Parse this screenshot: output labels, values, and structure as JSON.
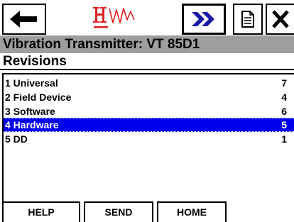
{
  "logo": {
    "text": "HW"
  },
  "toolbar": {
    "back_icon": "left-arrow-icon",
    "forward_icon": "double-chevron-right-icon",
    "doc_icon": "document-icon",
    "close_icon": "close-x-icon"
  },
  "header": {
    "title": "Vibration Transmitter: VT 85D1",
    "subtitle": "Revisions"
  },
  "revisions": [
    {
      "label": "1 Universal",
      "value": "7",
      "selected": false
    },
    {
      "label": "2 Field Device",
      "value": "4",
      "selected": false
    },
    {
      "label": "3 Software",
      "value": "6",
      "selected": false
    },
    {
      "label": "4 Hardware",
      "value": "5",
      "selected": true
    },
    {
      "label": "5 DD",
      "value": "1",
      "selected": false
    }
  ],
  "bottom_bar": {
    "help_label": "HELP",
    "send_label": "SEND",
    "home_label": "HOME"
  },
  "colors": {
    "title_bar": "#9e9e9e",
    "selection": "#0000ee",
    "logo_red": "#dd2222"
  }
}
